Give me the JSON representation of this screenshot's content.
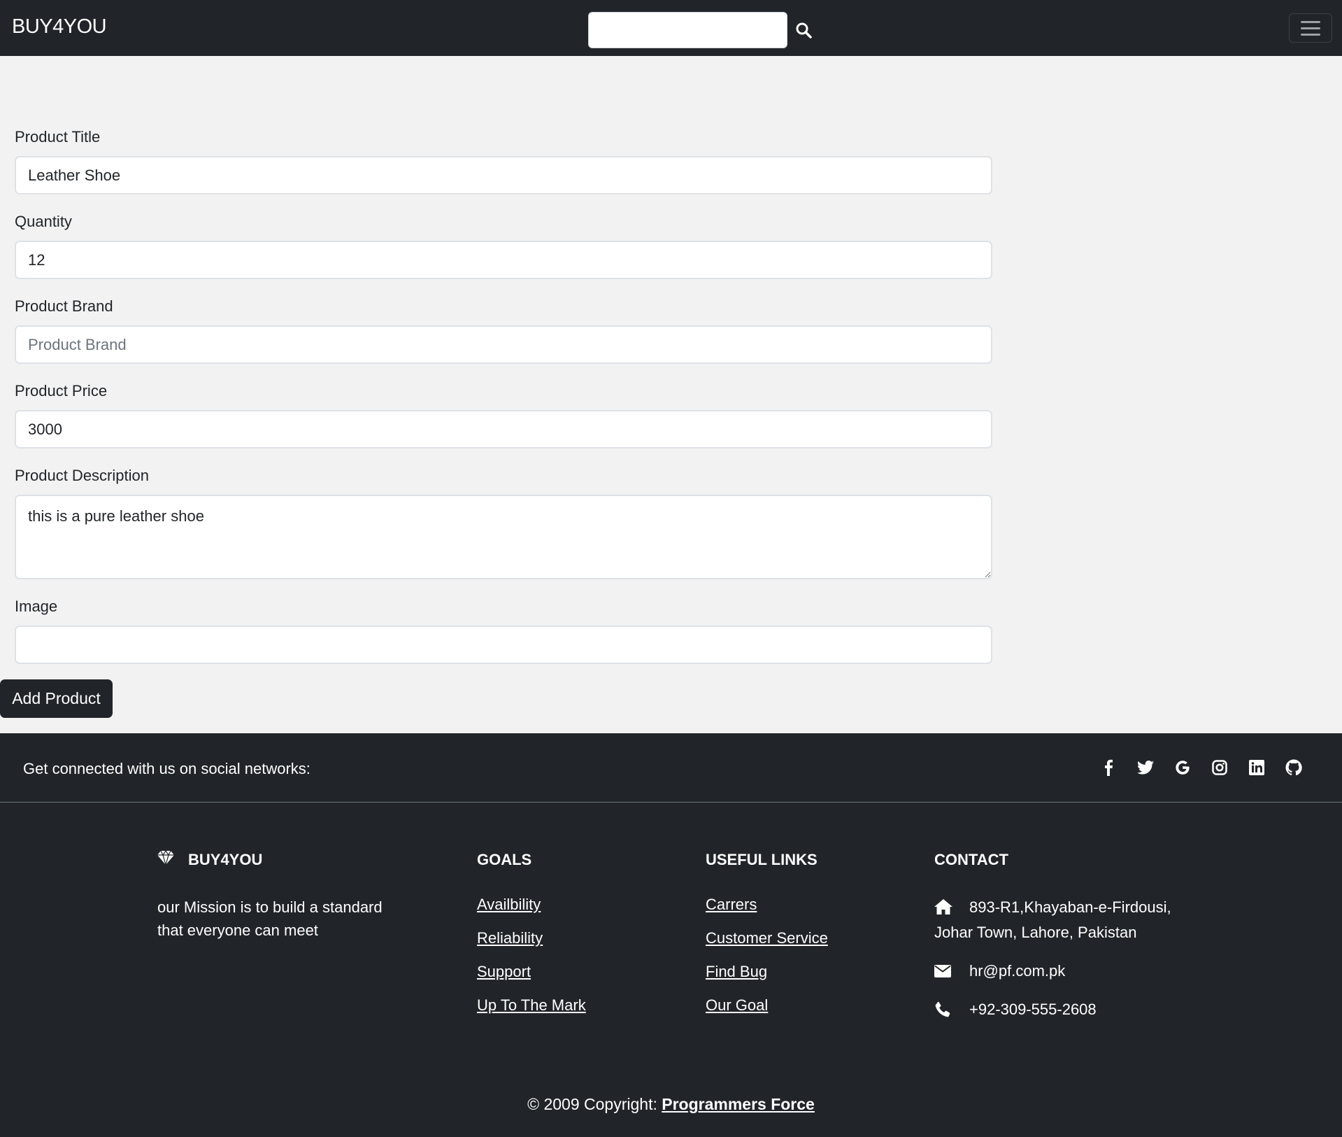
{
  "navbar": {
    "brand": "BUY4YOU",
    "search_placeholder": "",
    "search_value": ""
  },
  "form": {
    "title_label": "Product Title",
    "title_value": "Leather Shoe",
    "quantity_label": "Quantity",
    "quantity_value": "12",
    "brand_label": "Product Brand",
    "brand_placeholder": "Product Brand",
    "brand_value": "",
    "price_label": "Product Price",
    "price_value": "3000",
    "description_label": "Product Description",
    "description_value": "this is a pure leather shoe",
    "image_label": "Image",
    "image_value": "",
    "submit_label": "Add Product"
  },
  "footer": {
    "social_text": "Get connected with us on social networks:",
    "social_icons": [
      "facebook-icon",
      "twitter-icon",
      "google-icon",
      "instagram-icon",
      "linkedin-icon",
      "github-icon"
    ],
    "about": {
      "heading": "BUY4YOU",
      "text": "our Mission is to build a standard that everyone can meet"
    },
    "goals": {
      "heading": "GOALS",
      "links": [
        "Availbility",
        "Reliability",
        "Support",
        "Up To The Mark"
      ]
    },
    "useful_links": {
      "heading": "USEFUL LINKS",
      "links": [
        "Carrers",
        "Customer Service",
        "Find Bug",
        "Our Goal"
      ]
    },
    "contact": {
      "heading": "CONTACT",
      "address": "893-R1,Khayaban-e-Firdousi, Johar Town, Lahore, Pakistan",
      "email": "hr@pf.com.pk",
      "phone": "+92-309-555-2608"
    },
    "copyright_prefix": "© 2009 Copyright: ",
    "copyright_link": "Programmers Force"
  },
  "colors": {
    "dark": "#212529",
    "page_bg": "#f2f2f2",
    "white": "#ffffff"
  }
}
